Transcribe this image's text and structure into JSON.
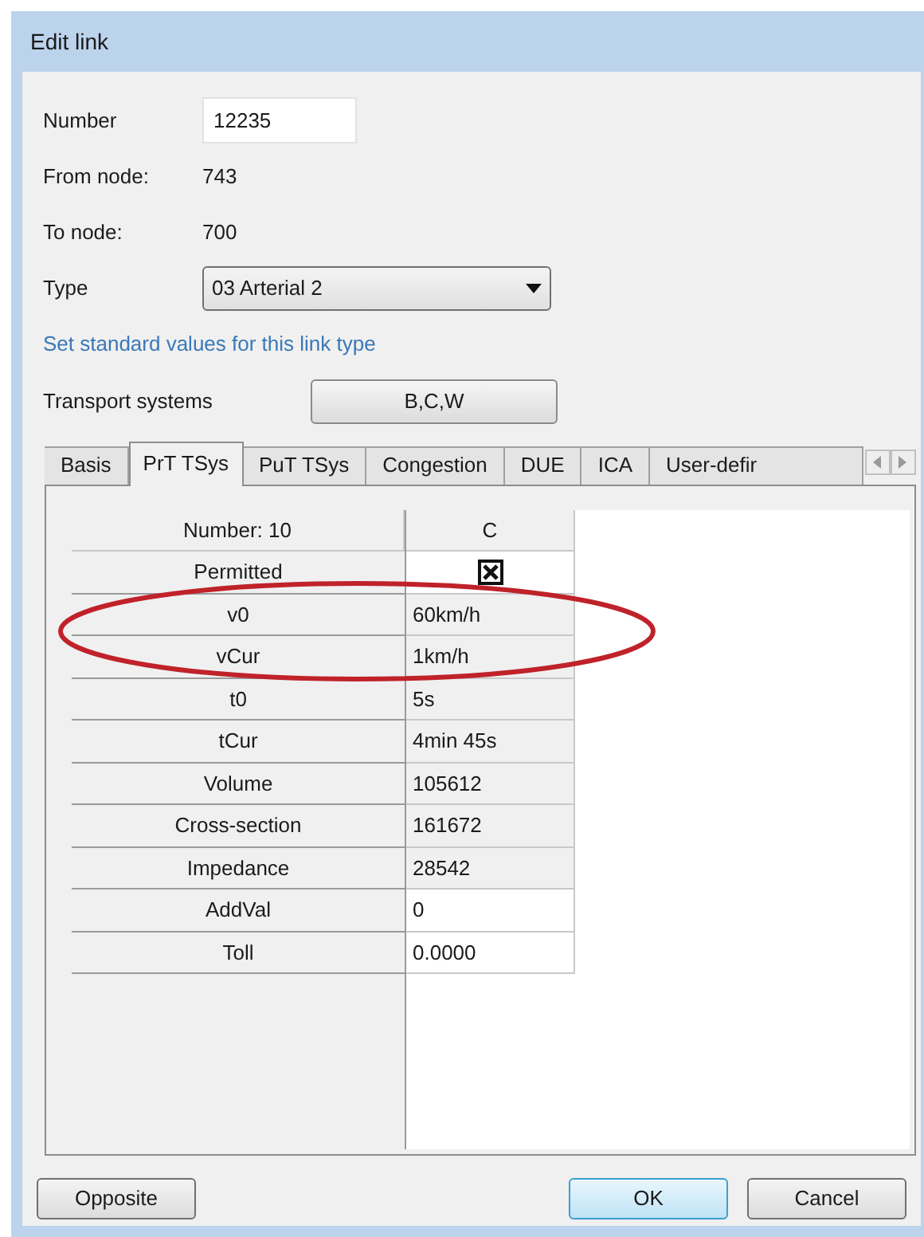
{
  "window": {
    "title": "Edit link"
  },
  "fields": [
    {
      "kind": "input",
      "label": "Number",
      "value": "12235"
    },
    {
      "kind": "text",
      "label": "From node:",
      "value": "743"
    },
    {
      "kind": "text",
      "label": "To node:",
      "value": "700"
    },
    {
      "kind": "dropdown",
      "label": "Type",
      "value": "03 Arterial 2"
    }
  ],
  "link": "Set standard values for this link type",
  "transport_systems": {
    "label": "Transport systems",
    "button": "B,C,W"
  },
  "tabs": [
    {
      "label": "Basis",
      "selected": false
    },
    {
      "label": "PrT TSys",
      "selected": true
    },
    {
      "label": "PuT TSys",
      "selected": false
    },
    {
      "label": "Congestion",
      "selected": false
    },
    {
      "label": "DUE",
      "selected": false
    },
    {
      "label": "ICA",
      "selected": false
    },
    {
      "label": "User-defir",
      "selected": false
    }
  ],
  "grid": {
    "header": [
      "Number: 10",
      "C"
    ],
    "rows": [
      {
        "label": "Permitted",
        "kind": "checkbox",
        "checked": true,
        "editable": true
      },
      {
        "label": "v0",
        "kind": "text",
        "value": "60km/h",
        "editable": false
      },
      {
        "label": "vCur",
        "kind": "text",
        "value": "1km/h",
        "editable": false
      },
      {
        "label": "t0",
        "kind": "text",
        "value": "5s",
        "editable": false
      },
      {
        "label": "tCur",
        "kind": "text",
        "value": "4min 45s",
        "editable": false
      },
      {
        "label": "Volume",
        "kind": "text",
        "value": "105612",
        "editable": false
      },
      {
        "label": "Cross-section",
        "kind": "text",
        "value": "161672",
        "editable": false
      },
      {
        "label": "Impedance",
        "kind": "text",
        "value": "28542",
        "editable": false
      },
      {
        "label": "AddVal",
        "kind": "text",
        "value": "0",
        "editable": true
      },
      {
        "label": "Toll",
        "kind": "text",
        "value": "0.0000",
        "editable": true
      }
    ]
  },
  "buttons": [
    {
      "label": "Opposite",
      "default": false
    },
    {
      "label": "OK",
      "default": true
    },
    {
      "label": "Cancel",
      "default": false
    }
  ]
}
